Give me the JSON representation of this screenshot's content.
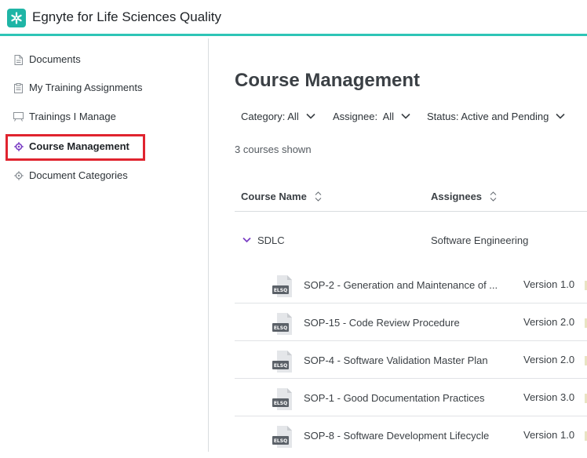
{
  "app": {
    "title": "Egnyte for Life Sciences Quality",
    "brand_color": "#1fb5a6",
    "accent_line": "#2ec5b6"
  },
  "sidebar": {
    "items": [
      {
        "label": "Documents",
        "icon": "document-icon"
      },
      {
        "label": "My Training Assignments",
        "icon": "clipboard-icon"
      },
      {
        "label": "Trainings I Manage",
        "icon": "presentation-board-icon"
      },
      {
        "label": "Course Management",
        "icon": "gear-icon",
        "active": true
      },
      {
        "label": "Document Categories",
        "icon": "gear-icon"
      }
    ],
    "highlight_color": "#e0242f"
  },
  "main": {
    "title": "Course Management",
    "filters": [
      {
        "label": "Category: All"
      },
      {
        "label": "Assignee:  All"
      },
      {
        "label": "Status: Active and Pending"
      }
    ],
    "count_text": "3 courses shown",
    "columns": [
      {
        "label": "Course Name"
      },
      {
        "label": "Assignees"
      }
    ],
    "group": {
      "name": "SDLC",
      "assignees": "Software Engineering",
      "expanded": true
    },
    "documents": [
      {
        "name": "SOP-2 - Generation and Maintenance of ...",
        "version": "Version 1.0",
        "file_badge": "ELSQ"
      },
      {
        "name": "SOP-15 - Code Review Procedure",
        "version": "Version 2.0",
        "file_badge": "ELSQ"
      },
      {
        "name": "SOP-4 - Software Validation Master Plan",
        "version": "Version 2.0",
        "file_badge": "ELSQ"
      },
      {
        "name": "SOP-1 - Good Documentation Practices",
        "version": "Version 3.0",
        "file_badge": "ELSQ"
      },
      {
        "name": "SOP-8 - Software Development Lifecycle",
        "version": "Version 1.0",
        "file_badge": "ELSQ"
      }
    ]
  }
}
